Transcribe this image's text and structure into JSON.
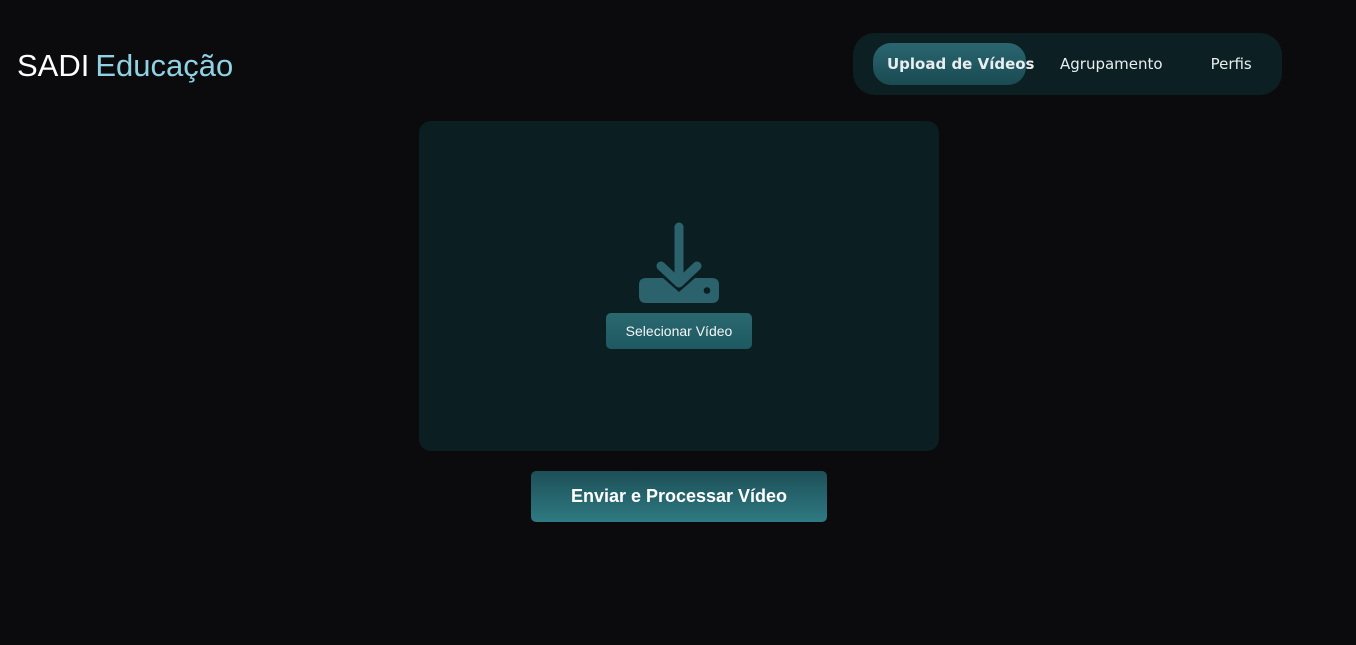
{
  "brand": {
    "main": "SADI",
    "sub": "Educação"
  },
  "nav": {
    "items": [
      {
        "label": "Upload de Vídeos",
        "active": true
      },
      {
        "label": "Agrupamento",
        "active": false
      },
      {
        "label": "Perfis",
        "active": false
      }
    ]
  },
  "upload": {
    "icon": "download-icon",
    "select_label": "Selecionar Vídeo"
  },
  "actions": {
    "submit_label": "Enviar e Processar Vídeo"
  },
  "colors": {
    "background": "#0b0b0d",
    "card": "#0b1f23",
    "accent": "#2a6670",
    "brand_sub": "#8fd2e3",
    "icon": "#2b626b"
  }
}
